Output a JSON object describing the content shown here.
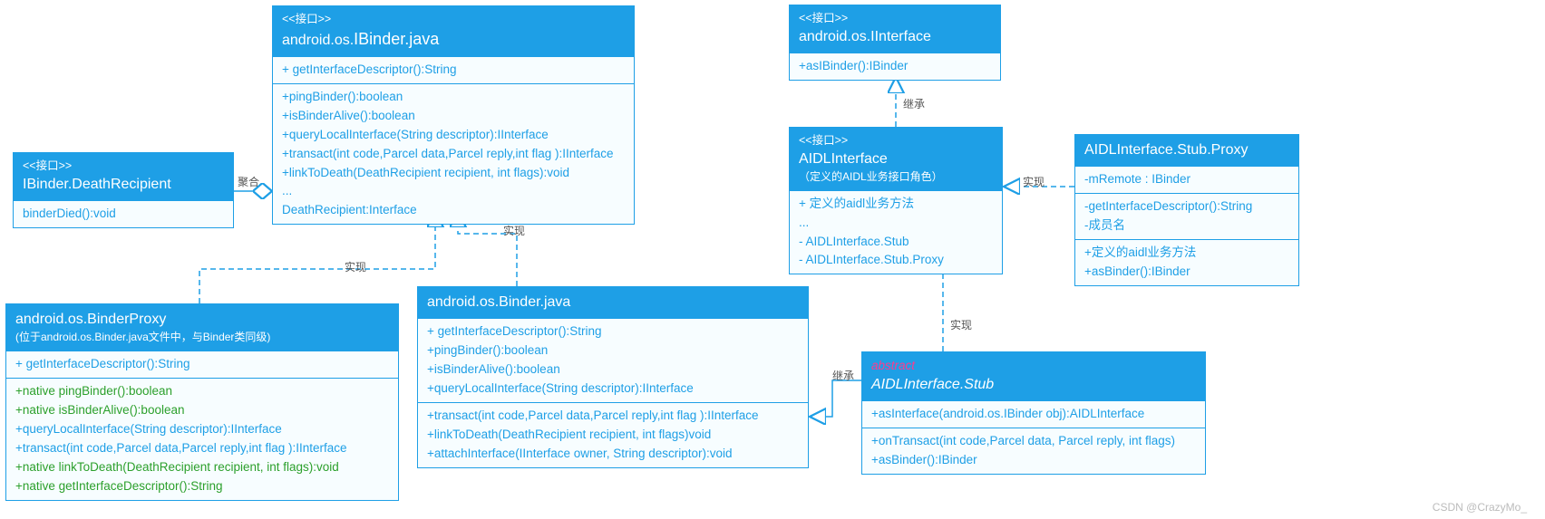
{
  "watermark": "CSDN @CrazyMo_",
  "labels": {
    "aggregation": "聚合",
    "realize1": "实现",
    "realize2": "实现",
    "inherit1": "继承",
    "inherit2": "继承",
    "realize3": "实现",
    "realize4": "实现"
  },
  "deathRecipient": {
    "stereo": "<<接口>>",
    "title": "IBinder.DeathRecipient",
    "m1": "binderDied():void"
  },
  "ibinder": {
    "stereo": "<<接口>>",
    "titlePre": "android.os.",
    "titleBig": "IBinder.java",
    "m1": "+ getInterfaceDescriptor():String",
    "m2": "+pingBinder():boolean",
    "m3": "+isBinderAlive():boolean",
    "m4": "+queryLocalInterface(String descriptor):IInterface",
    "m5": "+transact(int code,Parcel data,Parcel reply,int flag ):IInterface",
    "m6": "+linkToDeath(DeathRecipient recipient, int flags):void",
    "m7": "...",
    "m8": "DeathRecipient:Interface"
  },
  "iinterface": {
    "stereo": "<<接口>>",
    "title": "android.os.IInterface",
    "m1": "+asIBinder():IBinder"
  },
  "aidlInterface": {
    "stereo": "<<接口>>",
    "title": "AIDLInterface",
    "subtitle": "（定义的AIDL业务接口角色）",
    "m1": "+ 定义的aidl业务方法",
    "m2": "...",
    "m3": "- AIDLInterface.Stub",
    "m4": "- AIDLInterface.Stub.Proxy"
  },
  "proxy": {
    "title": "AIDLInterface.Stub.Proxy",
    "m1": "-mRemote  :  IBinder",
    "m2": "-getInterfaceDescriptor():String",
    "m3": "-成员名",
    "m4": "+定义的aidl业务方法",
    "m5": "+asBinder():IBinder"
  },
  "binderProxy": {
    "title": "android.os.BinderProxy",
    "subtitle": "(位于android.os.Binder.java文件中，与Binder类同级)",
    "m1": "+ getInterfaceDescriptor():String",
    "m2": "+native pingBinder():boolean",
    "m3": "+native isBinderAlive():boolean",
    "m4": "+queryLocalInterface(String descriptor):IInterface",
    "m5": "+transact(int code,Parcel data,Parcel reply,int flag ):IInterface",
    "m6": "+native linkToDeath(DeathRecipient recipient, int flags):void",
    "m7": "+native getInterfaceDescriptor():String"
  },
  "binder": {
    "title": "android.os.Binder.java",
    "m1": "+ getInterfaceDescriptor():String",
    "m2": "+pingBinder():boolean",
    "m3": "+isBinderAlive():boolean",
    "m4": "+queryLocalInterface(String descriptor):IInterface",
    "m5": "+transact(int code,Parcel data,Parcel reply,int flag ):IInterface",
    "m6": "+linkToDeath(DeathRecipient recipient, int flags)void",
    "m7": "+attachInterface(IInterface owner, String descriptor):void"
  },
  "stub": {
    "abstract": "abstract",
    "title": "AIDLInterface.Stub",
    "m1": "+asInterface(android.os.IBinder obj):AIDLInterface",
    "m2": "+onTransact(int code,Parcel data, Parcel reply, int flags)",
    "m3": "+asBinder():IBinder"
  }
}
